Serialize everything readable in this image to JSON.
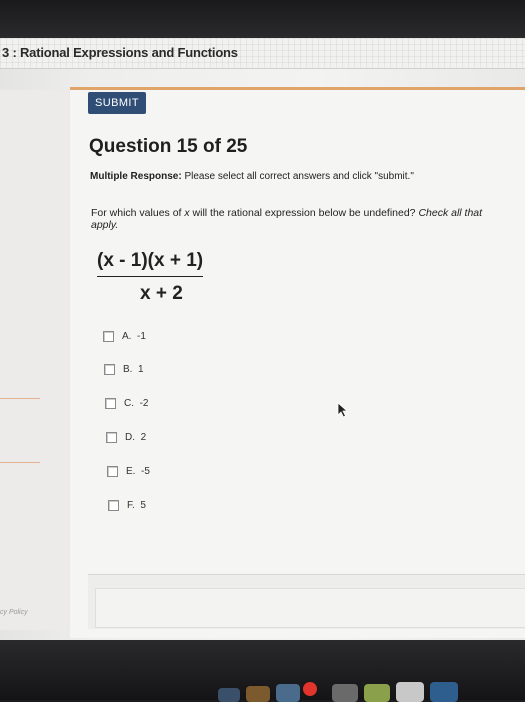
{
  "header": {
    "course_title": "3 : Rational Expressions and Functions"
  },
  "toolbar": {
    "submit_label": "SUBMIT"
  },
  "question": {
    "title": "Question 15 of 25",
    "instructions_label": "Multiple Response:",
    "instructions_text": " Please select all correct answers and click \"submit.\"",
    "prompt_pre": "For which values of ",
    "prompt_var": "x",
    "prompt_mid": " will the rational expression below be undefined? ",
    "prompt_emph": "Check all that apply.",
    "expression": {
      "numerator": "(x - 1)(x + 1)",
      "denominator": "x + 2"
    },
    "choices": [
      {
        "letter": "A.",
        "value": "-1"
      },
      {
        "letter": "B.",
        "value": "1"
      },
      {
        "letter": "C.",
        "value": "-2"
      },
      {
        "letter": "D.",
        "value": "2"
      },
      {
        "letter": "E.",
        "value": "-5"
      },
      {
        "letter": "F.",
        "value": "5"
      }
    ]
  },
  "footer": {
    "privacy_text": "cy Policy"
  },
  "colors": {
    "submit_bg": "#2f4d75",
    "accent_rule": "#e0a46a"
  }
}
